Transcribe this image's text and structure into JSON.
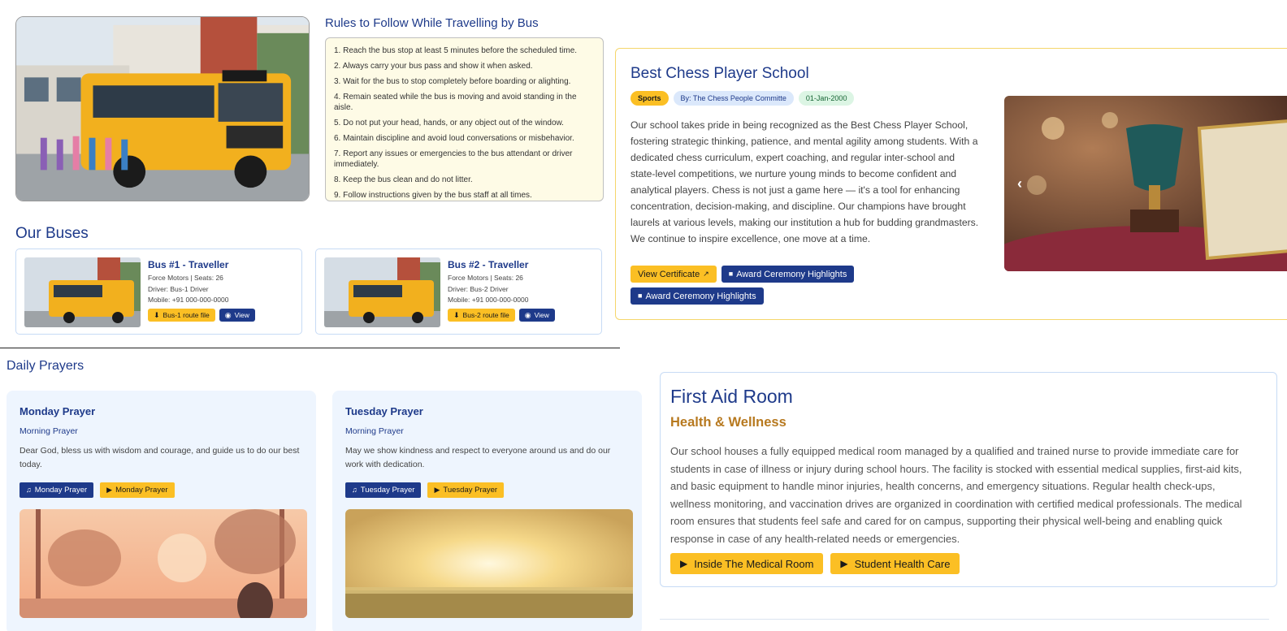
{
  "rules": {
    "title": "Rules to Follow While Travelling by Bus",
    "items": [
      "1. Reach the bus stop at least 5 minutes before the scheduled time.",
      "2. Always carry your bus pass and show it when asked.",
      "3. Wait for the bus to stop completely before boarding or alighting.",
      "4. Remain seated while the bus is moving and avoid standing in the aisle.",
      "5. Do not put your head, hands, or any object out of the window.",
      "6. Maintain discipline and avoid loud conversations or misbehavior.",
      "7. Report any issues or emergencies to the bus attendant or driver immediately.",
      "8. Keep the bus clean and do not litter.",
      "9. Follow instructions given by the bus staff at all times."
    ]
  },
  "buses": {
    "title": "Our Buses",
    "items": [
      {
        "name": "Bus #1 - Traveller",
        "info": "Force Motors | Seats: 26",
        "driver": "Driver: Bus-1 Driver",
        "mobile": "Mobile: +91 000-000-0000",
        "route_label": "Bus-1 route file",
        "view_label": "View"
      },
      {
        "name": "Bus #2 - Traveller",
        "info": "Force Motors | Seats: 26",
        "driver": "Driver: Bus-2 Driver",
        "mobile": "Mobile: +91 000-000-0000",
        "route_label": "Bus-2 route file",
        "view_label": "View"
      }
    ]
  },
  "prayers": {
    "title": "Daily Prayers",
    "items": [
      {
        "title": "Monday Prayer",
        "subtitle": "Morning Prayer",
        "text": "Dear God, bless us with wisdom and courage, and guide us to do our best today.",
        "audio_label": "Monday Prayer",
        "video_label": "Monday Prayer"
      },
      {
        "title": "Tuesday Prayer",
        "subtitle": "Morning Prayer",
        "text": "May we show kindness and respect to everyone around us and do our work with dedication.",
        "audio_label": "Tuesday Prayer",
        "video_label": "Tuesday Prayer"
      }
    ]
  },
  "chess": {
    "title": "Best Chess Player School",
    "badge_category": "Sports",
    "badge_author": "By: The Chess People Committe",
    "badge_date": "01-Jan-2000",
    "description": "Our school takes pride in being recognized as the Best Chess Player School, fostering strategic thinking, patience, and mental agility among students. With a dedicated chess curriculum, expert coaching, and regular inter-school and state-level competitions, we nurture young minds to become confident and analytical players. Chess is not just a game here — it's a tool for enhancing concentration, decision-making, and discipline. Our champions have brought laurels at various levels, making our institution a hub for budding grandmasters. We continue to inspire excellence, one move at a time.",
    "certificate_label": "View Certificate",
    "video1_label": "Award Ceremony Highlights",
    "video2_label": "Award Ceremony Highlights"
  },
  "first_aid": {
    "title": "First Aid Room",
    "subtitle": "Health & Wellness",
    "description": "Our school houses a fully equipped medical room managed by a qualified and trained nurse to provide immediate care for students in case of illness or injury during school hours. The facility is stocked with essential medical supplies, first-aid kits, and basic equipment to handle minor injuries, health concerns, and emergency situations. Regular health check-ups, wellness monitoring, and vaccination drives are organized in coordination with certified medical professionals. The medical room ensures that students feel safe and cared for on campus, supporting their physical well-being and enabling quick response in case of any health-related needs or emergencies.",
    "button1_label": "Inside The Medical Room",
    "button2_label": "Student Health Care"
  },
  "colors": {
    "navy": "#1e3a8a",
    "gold": "#fbbf24",
    "amber_text": "#b7791f"
  }
}
